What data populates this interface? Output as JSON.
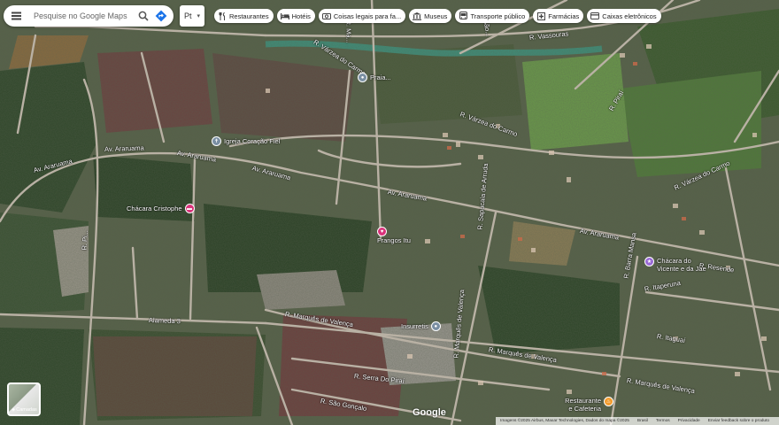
{
  "search": {
    "placeholder": "Pesquise no Google Maps"
  },
  "language": {
    "label": "Pt"
  },
  "chips": [
    {
      "label": "Restaurantes",
      "icon": "fork-knife-icon"
    },
    {
      "label": "Hotéis",
      "icon": "bed-icon"
    },
    {
      "label": "Coisas legais para fa...",
      "icon": "camera-icon"
    },
    {
      "label": "Museus",
      "icon": "museum-icon"
    },
    {
      "label": "Transporte público",
      "icon": "bus-icon"
    },
    {
      "label": "Farmácias",
      "icon": "pharmacy-icon"
    },
    {
      "label": "Caixas eletrônicos",
      "icon": "atm-icon"
    }
  ],
  "streets": [
    {
      "label": "R. Várzea do Carmo"
    },
    {
      "label": "R. Vassouras"
    },
    {
      "label": "R. Ma..."
    },
    {
      "label": "R. São..."
    },
    {
      "label": "R. Várzea do Carmo"
    },
    {
      "label": "R. Piraí"
    },
    {
      "label": "R. Várzea do Carmo"
    },
    {
      "label": "Av. Araruama"
    },
    {
      "label": "Av. Araruama"
    },
    {
      "label": "Av. Araruama"
    },
    {
      "label": "Av. Araruama"
    },
    {
      "label": "Av. Araruama"
    },
    {
      "label": "Av. Araruama"
    },
    {
      "label": "R. Resende"
    },
    {
      "label": "R. Itaperuna"
    },
    {
      "label": "R. Sapucaia de Arruda"
    },
    {
      "label": "R. Barra Mansa"
    },
    {
      "label": "Alameda 3"
    },
    {
      "label": "R. Marquês de Valença"
    },
    {
      "label": "R. Marquês de Valença"
    },
    {
      "label": "R. Marquês de Valença"
    },
    {
      "label": "R. Itaguaí"
    },
    {
      "label": "R. Serra Do Piraí"
    },
    {
      "label": "R. São Gonçalo"
    },
    {
      "label": "R. Marquês de Valença"
    },
    {
      "label": "R. Pi..."
    }
  ],
  "pois": [
    {
      "label": "Praia...",
      "color": "#7a8fa3"
    },
    {
      "label": "Igreja Coração Fiel",
      "color": "#7a8fa3"
    },
    {
      "label": "Chácara Cristophe",
      "color": "#d9327a"
    },
    {
      "label": "Frangos Itu",
      "color": "#d9327a"
    },
    {
      "label": "Chácara do Vicente e da Jae",
      "color": "#9a6ad6"
    },
    {
      "label": "Insurretis",
      "color": "#7a8fa3"
    },
    {
      "label": "Restaurante e Cafeteria",
      "color": "#f29b2c"
    }
  ],
  "layers": {
    "label": "Camadas"
  },
  "logo": {
    "text": "Google"
  },
  "attribution": {
    "imagery": "Imagens ©2025 Airbus, Maxar Technologies, Dados do mapa ©2025",
    "brazil": "Brasil",
    "terms": "Termos",
    "privacy": "Privacidade",
    "feedback": "Enviar feedback sobre o produto"
  },
  "colors": {
    "road": "#b9b1a4",
    "water": "#3d8f7a",
    "vegetation": "#2f4a2a",
    "field": "#6e4a3f"
  }
}
